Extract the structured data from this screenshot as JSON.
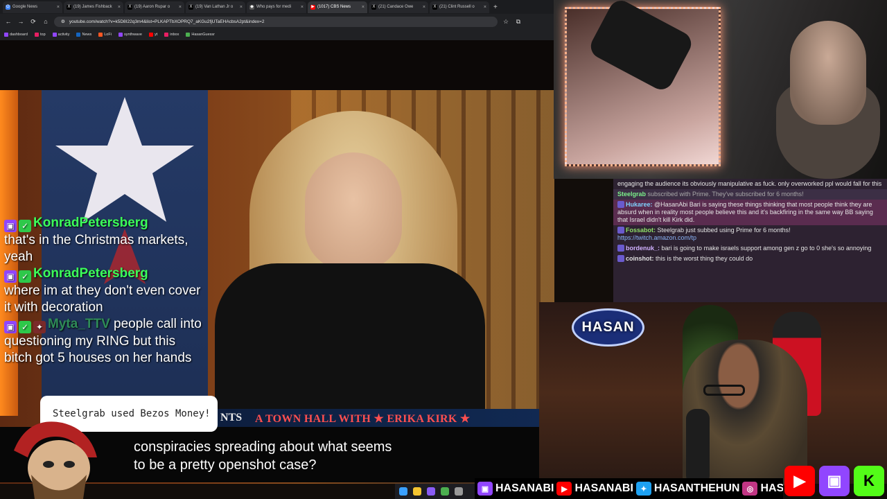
{
  "browser": {
    "tabs": [
      {
        "label": "Google News",
        "fav": "G",
        "fav_color": "#4285f4"
      },
      {
        "label": "(19) James Fishback",
        "fav": "X",
        "fav_color": "#000000"
      },
      {
        "label": "(19) Aaron Rupar o",
        "fav": "X",
        "fav_color": "#000000"
      },
      {
        "label": "(19) Van Lathan Jr o",
        "fav": "X",
        "fav_color": "#000000"
      },
      {
        "label": "Who pays for medi",
        "fav": "◆",
        "fav_color": "#555555"
      },
      {
        "label": "(1017) CBS News",
        "fav": "▶",
        "fav_color": "#ff0000"
      },
      {
        "label": "(21) Candace Owe",
        "fav": "X",
        "fav_color": "#000000"
      },
      {
        "label": "(21) Clint Russell o",
        "fav": "X",
        "fav_color": "#000000"
      }
    ],
    "url": "youtube.com/watch?v=k5D8I22q3m4&list=PLKAPTbXOPRQ7_aKGu2fjUTaEHAcbsA2pt&index=2",
    "bookmarks": [
      "dashboard",
      "top",
      "activity",
      "News",
      "LoFi",
      "synthwave",
      "yt",
      "inbox",
      "HasanGuessr"
    ]
  },
  "video": {
    "lower_third_left": "NTS",
    "lower_third_title": "A TOWN HALL WITH ★ ERIKA KIRK ★",
    "subtitle_line1": "conspiracies spreading about what seems",
    "subtitle_line2": "to be a pretty openshot case?"
  },
  "left_chat": [
    {
      "user": "KonradPetersberg",
      "color": "#3cff5a",
      "message": "that's in the Christmas markets, yeah"
    },
    {
      "user": "KonradPetersberg",
      "color": "#3cff5a",
      "message": "where im at they don't even cover it with decoration"
    },
    {
      "user": "Myta_TTV",
      "color": "#2e8b57",
      "message": "people call into questioning my RING but this bitch got 5 houses on her hands"
    }
  ],
  "alert": {
    "text": "Steelgrab used Bezos Money!"
  },
  "right_chat": [
    {
      "type": "msg",
      "user": "",
      "text": "engaging the audience its obviously manipulative as fuck. only overworked ppl would fall for this"
    },
    {
      "type": "sub",
      "user": "Steelgrab",
      "text": "subscribed with Prime. They've subscribed for 6 months!"
    },
    {
      "type": "hl",
      "user": "Hukaree:",
      "text": "@HasanAbi Bari is saying these things thinking that most people think they are absurd when in reality most people believe this and it's backfiring in the same way BB saying that Israel didn't kill Kirk did."
    },
    {
      "type": "msg",
      "user": "Fossabot:",
      "text": "Steelgrab just subbed using Prime for 6 months!",
      "link": "https://twitch.amazon.com/tp"
    },
    {
      "type": "msg",
      "user": "bordenuk_:",
      "text": "bari is going to make israels support among gen z go to 0 she's so annoying"
    },
    {
      "type": "msg",
      "user": "coinshot:",
      "text": "this is the worst thing they could do"
    }
  ],
  "cam2": {
    "sign": "HASAN"
  },
  "social_bar": [
    "HASANABI",
    "HASANABI",
    "HASANTHEHUN",
    "HASANABI"
  ],
  "colors": {
    "twitch": "#9146ff",
    "youtube": "#ff0000",
    "kick": "#53fc18"
  }
}
